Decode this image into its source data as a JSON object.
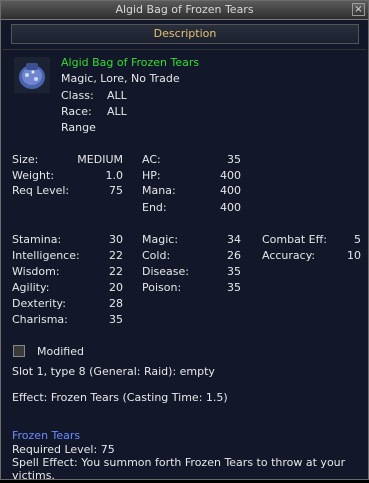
{
  "window": {
    "title": "Algid Bag of Frozen Tears",
    "close_glyph": "×"
  },
  "tab": {
    "label": "Description"
  },
  "item": {
    "name": "Algid Bag of Frozen Tears",
    "flags": "Magic, Lore, No Trade",
    "class_label": "Class:",
    "class_value": "ALL",
    "race_label": "Race:",
    "race_value": "ALL",
    "range_label": "Range",
    "icon": "blue-bag-icon"
  },
  "stats": {
    "size_label": "Size:",
    "size_value": "MEDIUM",
    "weight_label": "Weight:",
    "weight_value": "1.0",
    "reqlevel_label": "Req Level:",
    "reqlevel_value": "75",
    "ac_label": "AC:",
    "ac_value": "35",
    "hp_label": "HP:",
    "hp_value": "400",
    "mana_label": "Mana:",
    "mana_value": "400",
    "end_label": "End:",
    "end_value": "400",
    "stamina_label": "Stamina:",
    "stamina_value": "30",
    "int_label": "Intelligence:",
    "int_value": "22",
    "wis_label": "Wisdom:",
    "wis_value": "22",
    "agi_label": "Agility:",
    "agi_value": "20",
    "dex_label": "Dexterity:",
    "dex_value": "28",
    "cha_label": "Charisma:",
    "cha_value": "35",
    "magic_label": "Magic:",
    "magic_value": "34",
    "cold_label": "Cold:",
    "cold_value": "26",
    "disease_label": "Disease:",
    "disease_value": "35",
    "poison_label": "Poison:",
    "poison_value": "35",
    "combat_label": "Combat Eff:",
    "combat_value": "5",
    "accuracy_label": "Accuracy:",
    "accuracy_value": "10"
  },
  "modified": {
    "label": "Modified",
    "checked": false
  },
  "slot": "Slot 1, type 8 (General: Raid): empty",
  "effect": "Effect: Frozen Tears (Casting Time: 1.5)",
  "spell": {
    "name": "Frozen Tears",
    "required": "Required Level: 75",
    "line1": "Spell Effect: You summon forth Frozen Tears to throw at your",
    "line2": "victims."
  },
  "colors": {
    "name": "#33dd33",
    "spell": "#6b8cff",
    "tab": "#e6c36b"
  }
}
